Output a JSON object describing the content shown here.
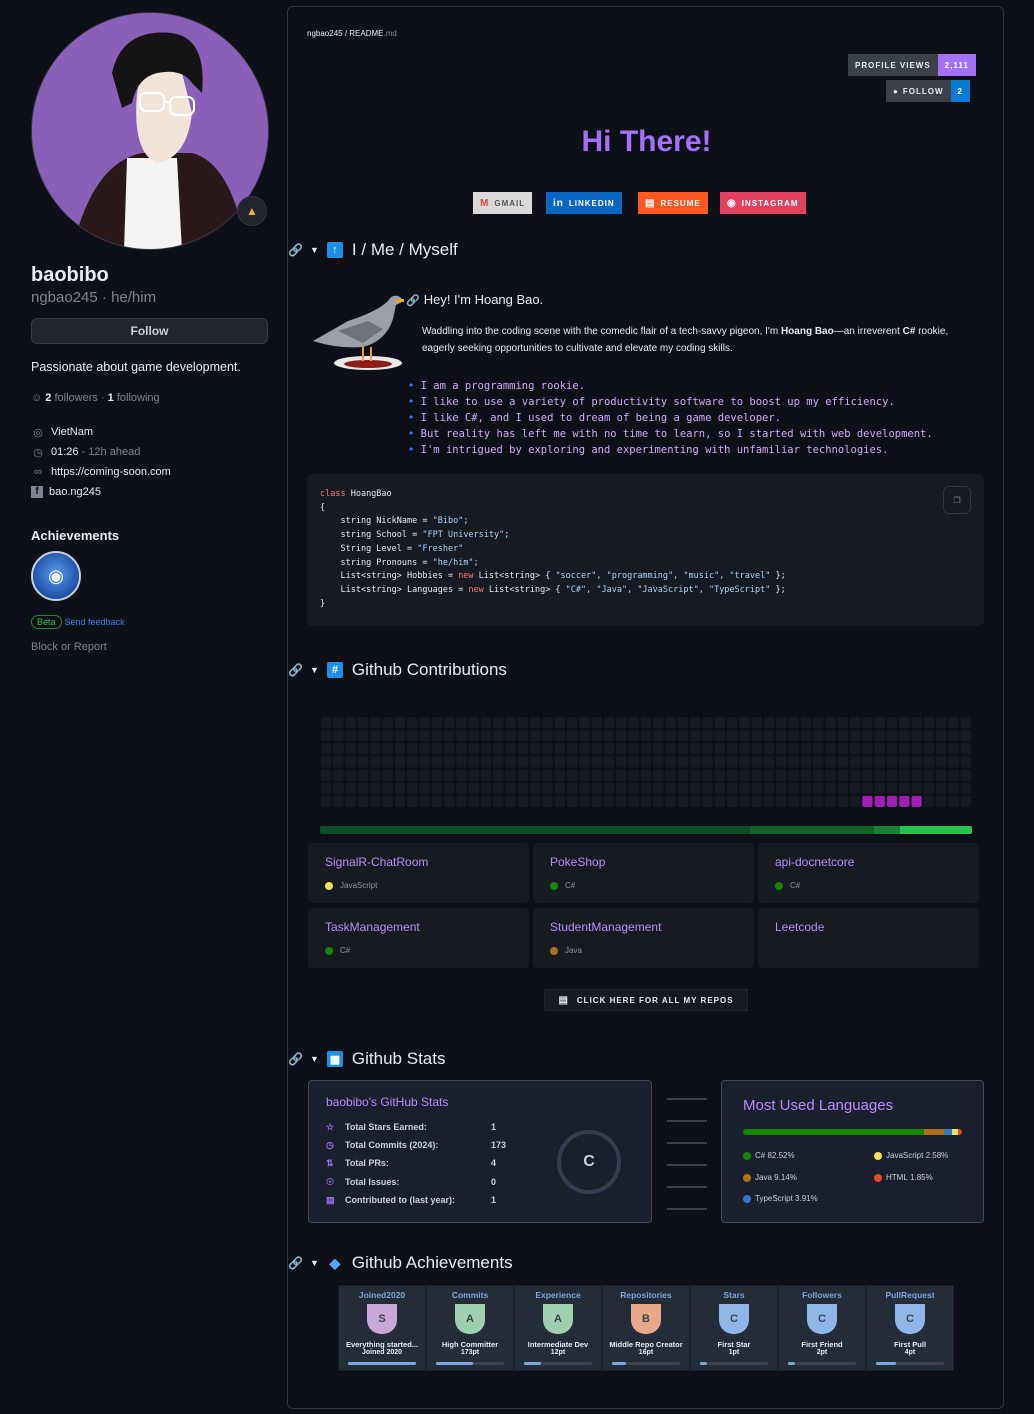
{
  "sidebar": {
    "name": "baobibo",
    "login": "ngbao245 · he/him",
    "follow_label": "Follow",
    "bio": "Passionate about game development.",
    "followers_count": "2",
    "followers_label": "followers ·",
    "following_count": "1",
    "following_label": "following",
    "location": "VietNam",
    "time": "01:26",
    "time_offset": "- 12h ahead",
    "website": "https://coming-soon.com",
    "facebook": "bao.ng245",
    "achievements_title": "Achievements",
    "beta_label": "Beta",
    "feedback_label": "Send feedback",
    "block_label": "Block or Report"
  },
  "readme": {
    "crumb_user": "ngbao245",
    "crumb_sep": " / ",
    "crumb_file": "README",
    "crumb_ext": ".md",
    "profile_views_label": "PROFILE VIEWS",
    "profile_views_count": "2,111",
    "follow_label": "FOLLOW",
    "follow_count": "2",
    "greeting": "Hi There!",
    "socials": [
      {
        "label": "GMAIL",
        "icon": "gmail-icon",
        "color": "#d9d9d9"
      },
      {
        "label": "LINKEDIN",
        "icon": "linkedin-icon",
        "color": "#0a66c2"
      },
      {
        "label": "RESUME",
        "icon": "resume-icon",
        "color": "#ff5722"
      },
      {
        "label": "INSTAGRAM",
        "icon": "instagram-icon",
        "color": "#e4405f"
      }
    ]
  },
  "about": {
    "heading": "I / Me / Myself",
    "hey": "Hey! I'm Hoang Bao.",
    "intro_1": "Waddling into the coding scene with the comedic flair of a tech-savvy pigeon, I'm ",
    "intro_name": "Hoang Bao",
    "intro_2": "—an irreverent ",
    "intro_lang": "C#",
    "intro_3": " rookie, eagerly seeking opportunities to cultivate and elevate my coding skills.",
    "bullets": [
      "I am a programming rookie.",
      "I like to use a variety of productivity software to boost up my efficiency.",
      "I like C#, and I used to dream of being a game developer.",
      "But reality has left me with no time to learn, so I started with web development.",
      "I'm intrigued by exploring and experimenting with unfamiliar technologies."
    ]
  },
  "code": {
    "class_kw": "class",
    "class_name": " HoangBao",
    "open": "{",
    "close": "}",
    "lines": [
      {
        "decl": "string NickName = ",
        "val": "\"Bibo\";"
      },
      {
        "decl": "string School = ",
        "val": "\"FPT University\";"
      },
      {
        "decl": "String Level = ",
        "val": "\"Fresher\""
      },
      {
        "decl": "string Pronouns = ",
        "val": "\"he/him\";"
      }
    ],
    "hobbies_decl": "List<string> Hobbies = ",
    "hobbies_new": "new",
    "hobbies_type": " List<string> { ",
    "hobbies_vals": "\"soccer\", \"programming\", \"music\", \"travel\"",
    "hobbies_end": " };",
    "langs_decl": "List<string> Languages = ",
    "langs_new": "new",
    "langs_type": " List<string> { ",
    "langs_vals": "\"C#\", \"Java\", \"JavaScript\", \"TypeScript\"",
    "langs_end": " };"
  },
  "contributions": {
    "heading": "Github Contributions",
    "weeks": 53,
    "days": 7,
    "active_cells": [
      [
        44,
        6
      ],
      [
        45,
        6
      ],
      [
        46,
        6
      ],
      [
        47,
        6
      ],
      [
        48,
        6
      ]
    ],
    "colors": {
      "empty": "#161b22",
      "active": "#9e1fb3",
      "grid": "#1a1f27"
    }
  },
  "repos": [
    {
      "name": "SignalR-ChatRoom",
      "lang": "JavaScript",
      "color": "#f1e05a"
    },
    {
      "name": "PokeShop",
      "lang": "C#",
      "color": "#178600"
    },
    {
      "name": "api-docnetcore",
      "lang": "C#",
      "color": "#178600"
    },
    {
      "name": "TaskManagement",
      "lang": "C#",
      "color": "#178600"
    },
    {
      "name": "StudentManagement",
      "lang": "Java",
      "color": "#b07219"
    },
    {
      "name": "Leetcode",
      "lang": "",
      "color": ""
    }
  ],
  "all_repos_label": "CLICK HERE FOR ALL MY REPOS",
  "stats": {
    "heading": "Github Stats",
    "title": "baobibo's GitHub Stats",
    "rows": [
      {
        "icon": "star-icon",
        "label": "Total Stars Earned:",
        "value": "1"
      },
      {
        "icon": "clock-icon",
        "label": "Total Commits (2024):",
        "value": "173"
      },
      {
        "icon": "pull-request-icon",
        "label": "Total PRs:",
        "value": "4"
      },
      {
        "icon": "issue-icon",
        "label": "Total Issues:",
        "value": "0"
      },
      {
        "icon": "repo-icon",
        "label": "Contributed to (last year):",
        "value": "1"
      }
    ],
    "rank": "C"
  },
  "languages": {
    "title": "Most Used Languages",
    "items": [
      {
        "name": "C#",
        "pct": "82.52%",
        "value": 82.52,
        "color": "#178600"
      },
      {
        "name": "JavaScript",
        "pct": "2.58%",
        "value": 2.58,
        "color": "#f1e05a"
      },
      {
        "name": "Java",
        "pct": "9.14%",
        "value": 9.14,
        "color": "#b07219"
      },
      {
        "name": "HTML",
        "pct": "1.85%",
        "value": 1.85,
        "color": "#e34c26"
      },
      {
        "name": "TypeScript",
        "pct": "3.91%",
        "value": 3.91,
        "color": "#3178c6"
      }
    ]
  },
  "achievements": {
    "heading": "Github Achievements",
    "trophies": [
      {
        "title": "Joined2020",
        "rank": "S",
        "desc": "Everything started...",
        "sub": "Joined 2020",
        "progress": 1.0,
        "color": "#c9a8d8"
      },
      {
        "title": "Commits",
        "rank": "A",
        "desc": "High Committer",
        "sub": "173pt",
        "progress": 0.55,
        "color": "#9fcfb1"
      },
      {
        "title": "Experience",
        "rank": "A",
        "desc": "Intermediate Dev",
        "sub": "12pt",
        "progress": 0.25,
        "color": "#9fcfb1"
      },
      {
        "title": "Repositories",
        "rank": "B",
        "desc": "Middle Repo Creator",
        "sub": "16pt",
        "progress": 0.2,
        "color": "#e7a98a"
      },
      {
        "title": "Stars",
        "rank": "C",
        "desc": "First Star",
        "sub": "1pt",
        "progress": 0.1,
        "color": "#8fb6e6"
      },
      {
        "title": "Followers",
        "rank": "C",
        "desc": "First Friend",
        "sub": "2pt",
        "progress": 0.1,
        "color": "#8fb6e6"
      },
      {
        "title": "PullRequest",
        "rank": "C",
        "desc": "First Pull",
        "sub": "4pt",
        "progress": 0.3,
        "color": "#8fb6e6"
      }
    ]
  }
}
